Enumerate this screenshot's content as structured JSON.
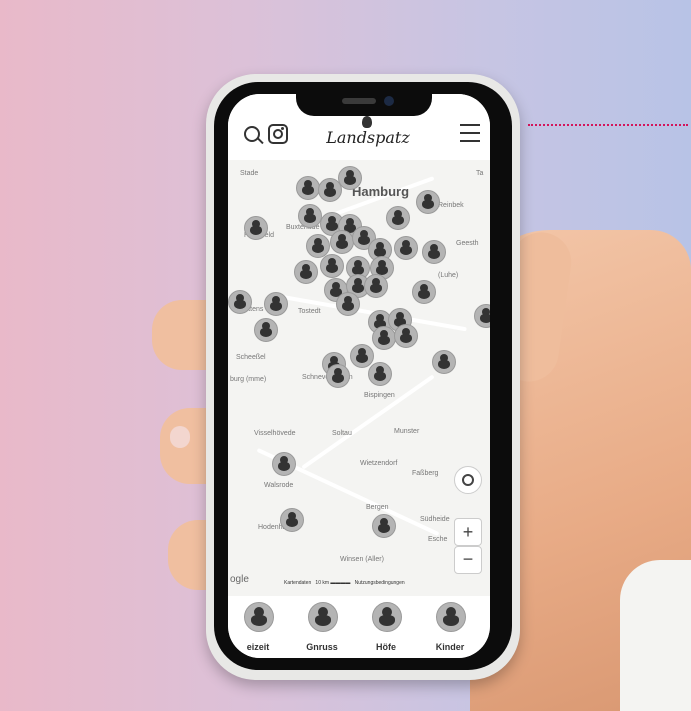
{
  "brand": {
    "logo_text": "Landspatz"
  },
  "header": {
    "search_icon": "search-icon",
    "social_icon": "instagram-icon",
    "menu_icon": "hamburger-menu-icon"
  },
  "map": {
    "places": {
      "stade": "Stade",
      "hamburg": "Hamburg",
      "buxtehude": "Buxtehude",
      "harsefeld": "Harsefeld",
      "reinbek": "Reinbek",
      "geesthacht": "Geesth",
      "luhe": "(Luhe)",
      "sittensen": "Sittens",
      "tostedt": "Tostedt",
      "scheessel": "Scheeßel",
      "rotenburg": "burg\n(mme)",
      "schneverdingen": "Schneverdingen",
      "bispingen": "Bispingen",
      "visselhoevede": "Visselhövede",
      "soltau": "Soltau",
      "munster": "Munster",
      "wietzendorf": "Wietzendorf",
      "fassberg": "Faßberg",
      "walsrode": "Walsrode",
      "hodenhagen": "Hodenhagen",
      "bergen": "Bergen",
      "suedheide": "Südheide",
      "eschede": "Esche",
      "winsen": "Winsen (Aller)",
      "ta": "Ta"
    },
    "controls": {
      "zoom_in": "+",
      "zoom_out": "−"
    },
    "attribution": {
      "data": "Kartendaten",
      "scale": "10 km",
      "terms": "Nutzungsbedingungen"
    },
    "google": "ogle"
  },
  "categories": [
    {
      "label": "eizeit"
    },
    {
      "label": "Gnruss"
    },
    {
      "label": "Höfe"
    },
    {
      "label": "Kinder"
    }
  ],
  "colors": {
    "accent": "#d4145a",
    "pin": "#b4b4b4"
  }
}
